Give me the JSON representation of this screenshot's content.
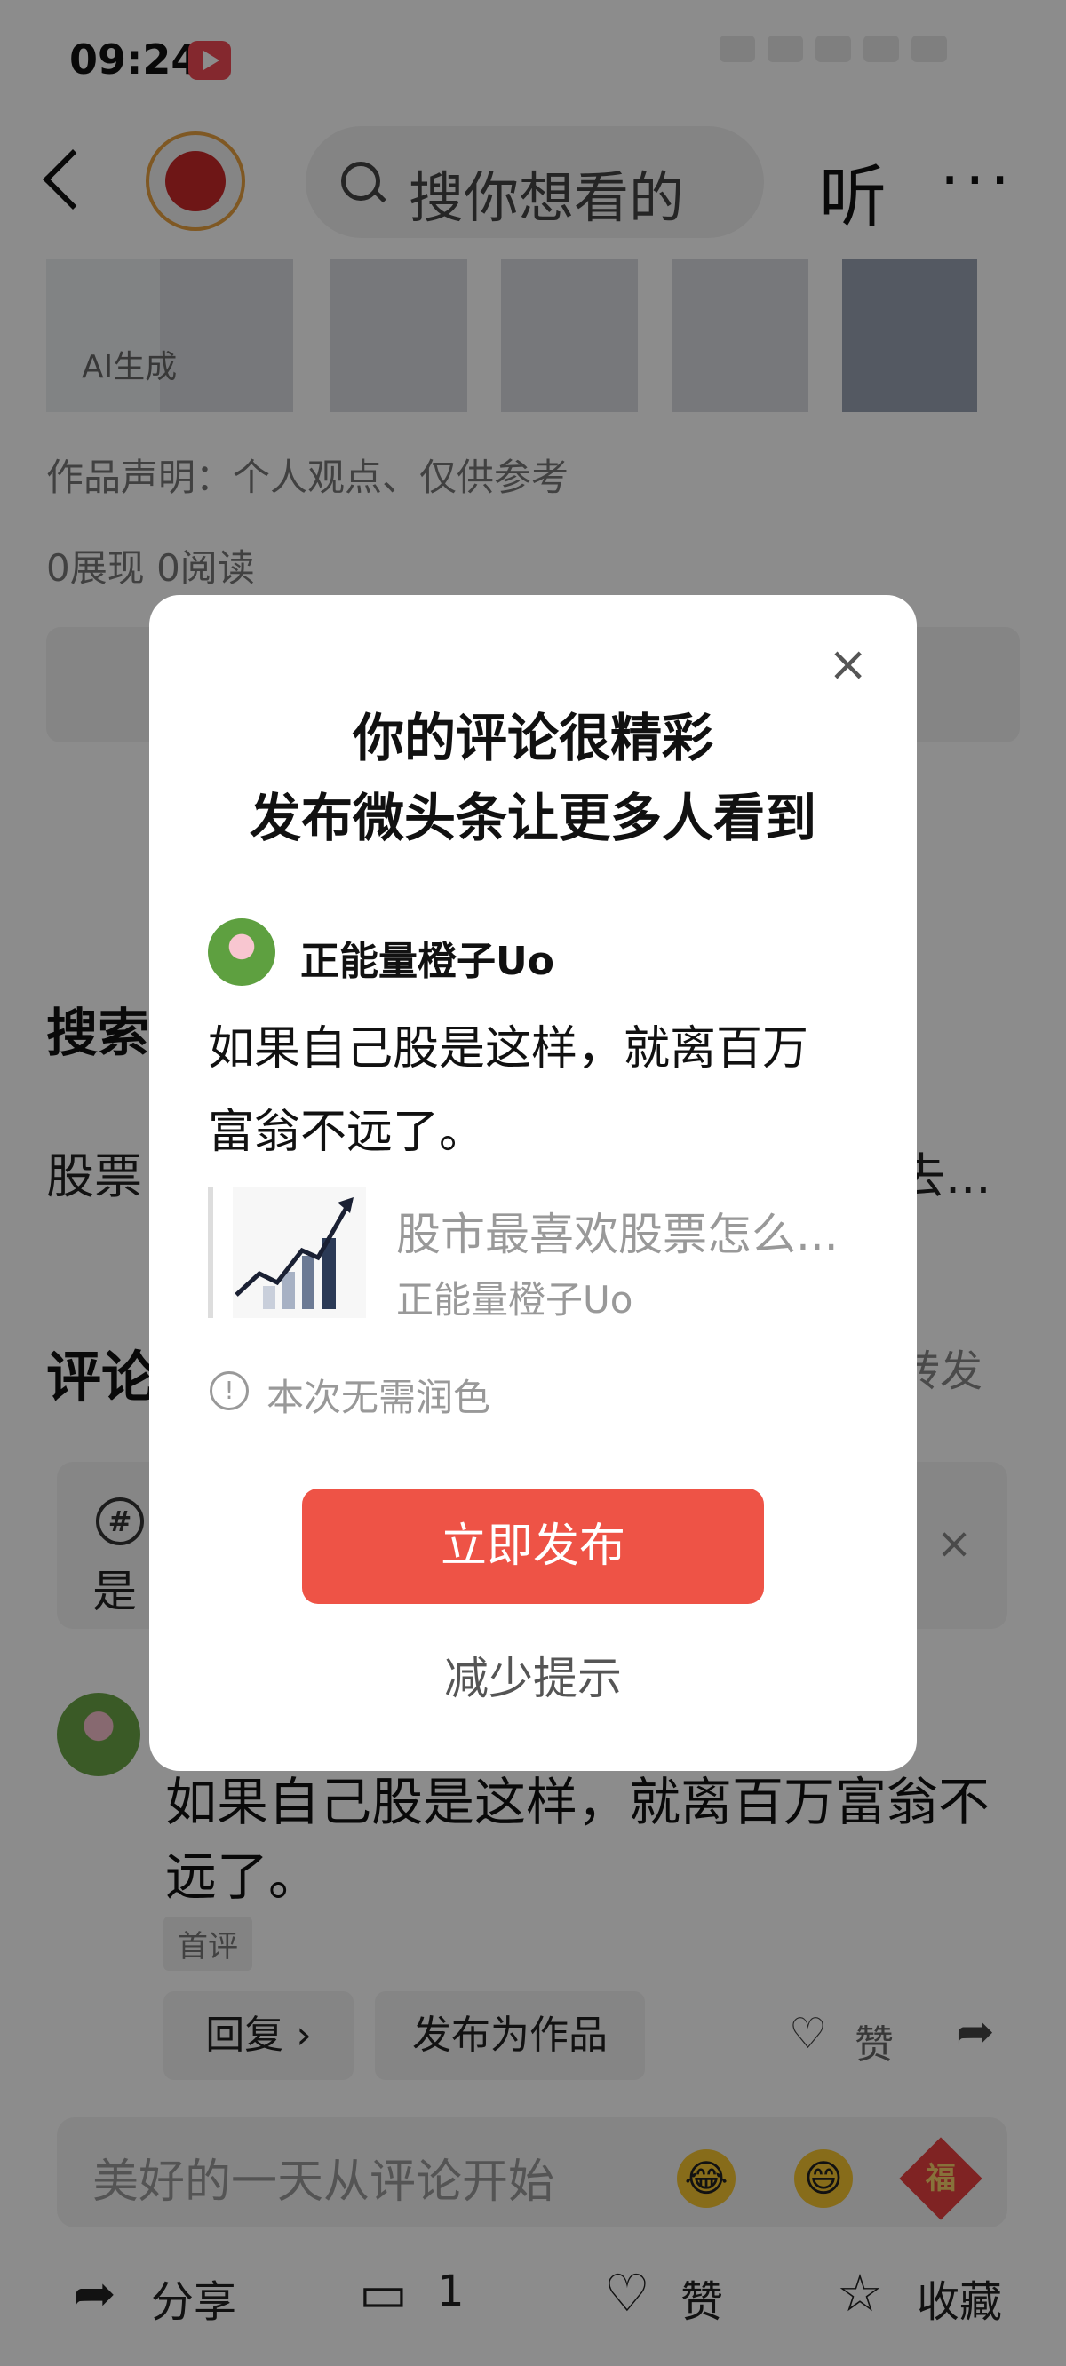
{
  "status_bar": {
    "time": "09:24"
  },
  "nav": {
    "search_placeholder": "搜你想看的",
    "listen_label": "听",
    "more_label": "···"
  },
  "article": {
    "ai_tag": "AI生成",
    "declaration": "作品声明：个人观点、仅供参考",
    "stats": "0展现  0阅读",
    "section_search": "搜索",
    "search_item_start": "股票",
    "search_item_end": "去...",
    "section_comment": "评论",
    "repost_label": "转发"
  },
  "topic": {
    "text_start": "是",
    "close": "×"
  },
  "comment": {
    "line1": "如果自己股是这样，就离百万富翁不",
    "line2": "远了。",
    "first_tag": "首评",
    "reply_label": "回复 ›",
    "publish_work_label": "发布为作品",
    "like_label": "赞"
  },
  "input": {
    "placeholder": "美好的一天从评论开始",
    "fu_label": "福"
  },
  "bottom_bar": {
    "share_label": "分享",
    "comment_count": "1",
    "like_label": "赞",
    "collect_label": "收藏"
  },
  "modal": {
    "close": "×",
    "title_line1": "你的评论很精彩",
    "title_line2": "发布微头条让更多人看到",
    "username": "正能量橙子Uo",
    "comment_line1": "如果自己股是这样，就离百万",
    "comment_line2": "富翁不远了。",
    "card_title": "股市最喜欢股票怎么...",
    "card_author": "正能量橙子Uo",
    "info_icon": "!",
    "info_text": "本次无需润色",
    "publish_button": "立即发布",
    "reduce_label": "减少提示"
  },
  "colors": {
    "publish_button": "#ee5346",
    "overlay": "rgba(0,0,0,0.45)"
  }
}
